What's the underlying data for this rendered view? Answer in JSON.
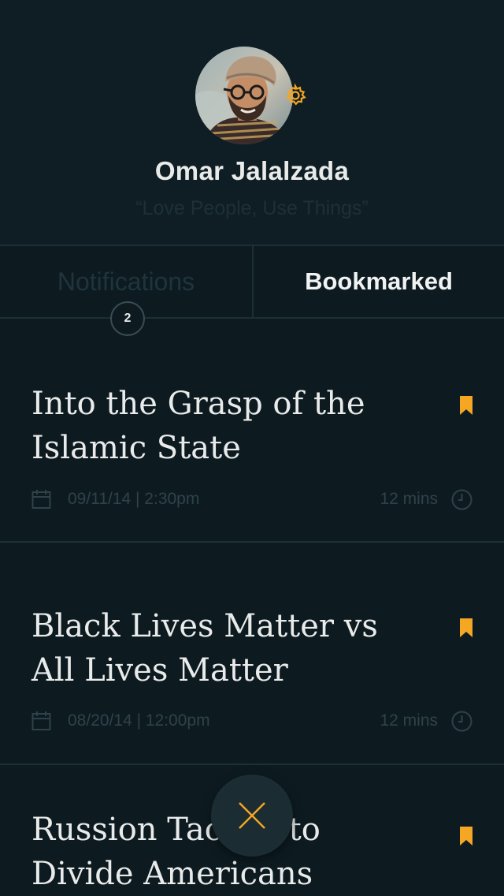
{
  "profile": {
    "name": "Omar Jalalzada",
    "quote": "“Love People, Use Things”"
  },
  "tabs": {
    "notifications_label": "Notifications",
    "notifications_count": "2",
    "bookmarked_label": "Bookmarked",
    "active": "Bookmarked"
  },
  "articles": [
    {
      "title_line1": "Into the Grasp of the",
      "title_line2": "Islamic State",
      "date": "09/11/14 | 2:30pm",
      "duration": "12 mins",
      "bookmarked": true
    },
    {
      "title_line1": "Black Lives Matter vs",
      "title_line2": "All Lives Matter",
      "date": "08/20/14 | 12:00pm",
      "duration": "12 mins",
      "bookmarked": true
    },
    {
      "title_line1": "Russion Tactics to",
      "title_line2": "Divide Americans",
      "bookmarked": true
    }
  ],
  "colors": {
    "background": "#0d1b21",
    "accent": "#f5a623",
    "text": "#e9ebeb",
    "muted": "#2f4249"
  },
  "icons": {
    "settings": "gear-icon",
    "bookmark": "bookmark-icon",
    "calendar": "calendar-icon",
    "clock": "clock-icon",
    "close": "close-icon"
  }
}
